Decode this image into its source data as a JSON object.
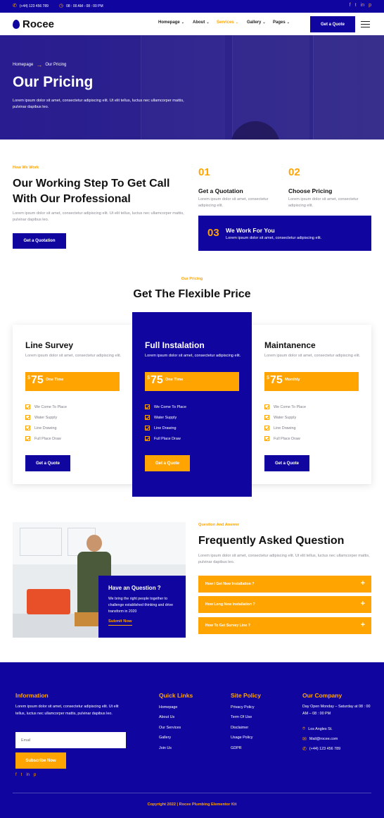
{
  "topbar": {
    "phone": "(+44) 123 456 789",
    "hours": "08 : 00 AM - 08 : 00 PM",
    "social": [
      "f",
      "t",
      "in",
      "p"
    ]
  },
  "header": {
    "brand": "Rocee",
    "nav": [
      {
        "label": "Homepage",
        "caret": "⌄"
      },
      {
        "label": "About",
        "caret": "⌄"
      },
      {
        "label": "Services",
        "caret": "⌄"
      },
      {
        "label": "Gallery",
        "caret": "⌄"
      },
      {
        "label": "Pages",
        "caret": "⌄"
      }
    ],
    "cta": "Get a Quote"
  },
  "hero": {
    "breadcrumb": {
      "home": "Homepage",
      "arrow": "→",
      "current": "Our Pricing"
    },
    "title": "Our Pricing",
    "desc": "Lorem ipsum dolor sit amet, consectetur adipiscing elit. Ut elit tellus, luctus nec ullamcorper mattis, pulvinar dapibus leo."
  },
  "steps_section": {
    "eyebrow": "How We Work",
    "title": "Our Working Step To Get Call With Our Professional",
    "desc": "Lorem ipsum dolor sit amet, consectetur adipiscing elit. Ut elit tellus, luctus nec ullamcorper mattis, pulvinar dapibus leo.",
    "button": "Get a Quotation",
    "steps": [
      {
        "num": "01",
        "title": "Get a Quotation",
        "desc": "Lorem ipsum dolor sit amet, consectetur adipiscing elit."
      },
      {
        "num": "02",
        "title": "Choose Pricing",
        "desc": "Lorem ipsum dolor sit amet, consectetur adipiscing elit."
      },
      {
        "num": "03",
        "title": "We Work For You",
        "desc": "Lorem ipsum dolor sit amet, consectetur adipiscing elit."
      }
    ]
  },
  "pricing": {
    "eyebrow": "Our Pricing",
    "title": "Get The Flexible Price",
    "plans": [
      {
        "name": "Line Survey",
        "desc": "Lorem ipsum dolor sit amet, consectetur adipiscing elit.",
        "currency": "$",
        "price": "75",
        "period": "One Time",
        "features": [
          "We Come To Place",
          "Water Supply",
          "Line Drawing",
          "Full Place Draw"
        ],
        "button": "Get a Quote"
      },
      {
        "name": "Full Instalation",
        "desc": "Lorem ipsum dolor sit amet, consectetur adipiscing elit.",
        "currency": "$",
        "price": "75",
        "period": "One Time",
        "features": [
          "We Come To Place",
          "Water Supply",
          "Line Drawing",
          "Full Place Draw"
        ],
        "button": "Get a Quote"
      },
      {
        "name": "Maintanence",
        "desc": "Lorem ipsum dolor sit amet, consectetur adipiscing elit.",
        "currency": "$",
        "price": "75",
        "period": "Monthly",
        "features": [
          "We Come To Place",
          "Water Supply",
          "Line Drawing",
          "Full Place Draw"
        ],
        "button": "Get a Quote"
      }
    ]
  },
  "faq": {
    "eyebrow": "Question And Answer",
    "title": "Frequently Asked Question",
    "desc": "Lorem ipsum dolor sit amet, consectetur adipiscing elit. Ut elit tellus, luctus nec ullamcorper mattis, pulvinar dapibus leo.",
    "items": [
      "How I Get New Installation ?",
      "How Long New Installation ?",
      "How To Get Survey Line ?"
    ],
    "plus": "+",
    "card": {
      "title": "Have an Question ?",
      "desc": "We bring the right people together to challenge established thinking and drive transform in 2020",
      "link": "Submit Now"
    }
  },
  "footer": {
    "info": {
      "title": "Information",
      "desc": "Lorem ipsum dolor sit amet, consectetur adipiscing elit. Ut elit tellus, luctus nec ullamcorper mattis, pulvinar dapibus leo.",
      "email_placeholder": "Email",
      "button": "Subscribe Now",
      "social": [
        "f",
        "t",
        "in",
        "p"
      ]
    },
    "quick": {
      "title": "Quick Links",
      "links": [
        "Homepage",
        "About Us",
        "Our Services",
        "Gallery",
        "Join Us"
      ]
    },
    "policy": {
      "title": "Site Policy",
      "links": [
        "Privacy Policy",
        "Term Of Use",
        "Disclaimer",
        "Usage Policy",
        "GDPR"
      ]
    },
    "company": {
      "title": "Our Company",
      "hours": "Day Open Monday – Saturday at 08 : 00 AM – 08 : 00 PM",
      "address": "Los Angles St.",
      "email": "Mail@rocee.com",
      "phone": "(+44) 123 456 789"
    },
    "copyright": "Copyright 2022 | Rocee Plumbing Elementor Kit"
  },
  "colors": {
    "navy": "#10069f",
    "orange": "#ffa400",
    "muted": "#8a8a95"
  }
}
